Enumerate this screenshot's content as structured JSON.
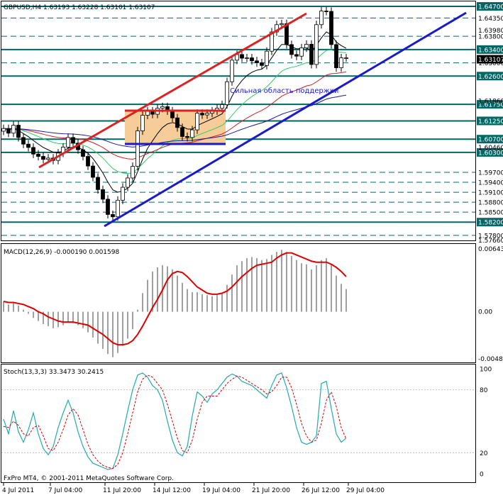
{
  "header": {
    "symbol_line": "GBPUSD,H4  1.63193 1.63228 1.63101 1.63107"
  },
  "chart_data": {
    "type": "candlestick",
    "symbol": "GBPUSD",
    "timeframe": "H4",
    "ohlc": {
      "open": 1.63193,
      "high": 1.63228,
      "low": 1.63101,
      "close": 1.63107
    },
    "price_range": [
      1.5767,
      1.6485
    ],
    "levels": [
      1.647,
      1.6435,
      1.638,
      1.634,
      1.63,
      1.626,
      1.6175,
      1.6125,
      1.607,
      1.603,
      1.597,
      1.594,
      1.591,
      1.588,
      1.585,
      1.582,
      1.578
    ],
    "level_labels": [
      "1.64700",
      "1.64350",
      "1.63800",
      "1.63400",
      "1.63000",
      "1.62600",
      "1.61750",
      "1.61250",
      "1.60700",
      "1.60300",
      "1.59700",
      "1.59400",
      "1.59100",
      "1.58800",
      "1.58500",
      "1.58200",
      "1.57800"
    ],
    "highlighted_labels": [
      "1.64700",
      "1.63400",
      "1.62600",
      "1.61750",
      "1.61250",
      "1.60700",
      "1.60300",
      "1.58200"
    ],
    "extra_price_labels": [
      "1.63980",
      "1.61860",
      "1.60460",
      "1.57660"
    ],
    "current_price_label": "1.63107",
    "x_tick_labels": [
      "4 Jul 2011",
      "7 Jul 04:00",
      "11 Jul 20:00",
      "14 Jul 12:00",
      "19 Jul 04:00",
      "21 Jul 20:00",
      "26 Jul 12:00",
      "29 Jul 04:00"
    ],
    "annotation": "Сильная область поддержки",
    "closes": [
      1.6102,
      1.6088,
      1.6112,
      1.6075,
      1.6055,
      1.6045,
      1.6025,
      1.6018,
      1.6009,
      1.6013,
      1.6006,
      1.6028,
      1.6046,
      1.6075,
      1.6058,
      1.6038,
      1.6018,
      1.5989,
      1.5955,
      1.5918,
      1.5889,
      1.5843,
      1.5836,
      1.5886,
      1.5925,
      1.5953,
      1.5988,
      1.6095,
      1.6142,
      1.6155,
      1.6145,
      1.6163,
      1.6168,
      1.6155,
      1.6134,
      1.6105,
      1.6078,
      1.6075,
      1.6098,
      1.6148,
      1.6143,
      1.6148,
      1.6155,
      1.6163,
      1.6174,
      1.6243,
      1.6308,
      1.6325,
      1.6314,
      1.6315,
      1.6306,
      1.63,
      1.6292,
      1.6335,
      1.6393,
      1.6415,
      1.6418,
      1.6355,
      1.6325,
      1.632,
      1.6345,
      1.6356,
      1.6295,
      1.6415,
      1.6456,
      1.6455,
      1.6355,
      1.6285,
      1.6315,
      1.6315
    ],
    "indicators": {
      "macd": {
        "label": "MACD(12,26,9) -0.000190 0.001598",
        "range": [
          -0.00484,
          0.00643
        ],
        "tick_labels": [
          "0.00643",
          "0.00",
          "-0.00484"
        ],
        "main": [
          0.001,
          0.0007,
          0.0009,
          0.0006,
          0.0002,
          -0.0002,
          -0.0006,
          -0.0009,
          -0.0012,
          -0.0014,
          -0.0016,
          -0.0015,
          -0.0013,
          -0.001,
          -0.0011,
          -0.0013,
          -0.0016,
          -0.002,
          -0.0025,
          -0.0031,
          -0.0036,
          -0.0041,
          -0.0044,
          -0.004,
          -0.0033,
          -0.0026,
          -0.0017,
          0.0002,
          0.0018,
          0.0031,
          0.0039,
          0.0043,
          0.0045,
          0.0044,
          0.0041,
          0.0035,
          0.0028,
          0.0022,
          0.0019,
          0.0019,
          0.0017,
          0.0016,
          0.0015,
          0.0016,
          0.0018,
          0.0026,
          0.0036,
          0.0045,
          0.0049,
          0.0052,
          0.0053,
          0.0052,
          0.005,
          0.0051,
          0.0055,
          0.0058,
          0.006,
          0.0058,
          0.0054,
          0.005,
          0.0047,
          0.0046,
          0.0041,
          0.0045,
          0.005,
          0.0052,
          0.0046,
          0.0035,
          0.0027,
          0.0022
        ],
        "signal": [
          0.001,
          0.0009,
          0.0009,
          0.0008,
          0.0007,
          0.0005,
          0.0003,
          0.0,
          -0.0002,
          -0.0005,
          -0.0007,
          -0.0009,
          -0.001,
          -0.001,
          -0.001,
          -0.0011,
          -0.0012,
          -0.0013,
          -0.0016,
          -0.0019,
          -0.0022,
          -0.0026,
          -0.003,
          -0.0032,
          -0.0032,
          -0.0031,
          -0.0028,
          -0.0022,
          -0.0014,
          -0.0005,
          0.0004,
          0.0012,
          0.0021,
          0.0031,
          0.0037,
          0.0039,
          0.0038,
          0.0034,
          0.0029,
          0.0024,
          0.0021,
          0.0018,
          0.0017,
          0.0017,
          0.0018,
          0.002,
          0.0024,
          0.0029,
          0.0034,
          0.0038,
          0.0042,
          0.0045,
          0.0046,
          0.0047,
          0.0048,
          0.0052,
          0.0055,
          0.0057,
          0.0057,
          0.0055,
          0.0053,
          0.0051,
          0.0049,
          0.0048,
          0.0048,
          0.0048,
          0.0046,
          0.0043,
          0.0039,
          0.0034
        ]
      },
      "stochastic": {
        "label": "Stoch(13,3,3) 33.3473 30.2415",
        "range": [
          0,
          100
        ],
        "tick_labels": [
          "100",
          "80",
          "20",
          "0"
        ],
        "k": [
          52,
          38,
          60,
          40,
          30,
          42,
          58,
          38,
          24,
          18,
          26,
          44,
          58,
          70,
          58,
          40,
          26,
          16,
          10,
          8,
          6,
          4,
          5,
          18,
          38,
          60,
          80,
          94,
          96,
          92,
          84,
          80,
          70,
          50,
          32,
          20,
          17,
          26,
          55,
          78,
          74,
          68,
          76,
          80,
          86,
          92,
          95,
          93,
          88,
          86,
          84,
          80,
          76,
          72,
          84,
          94,
          96,
          82,
          64,
          44,
          30,
          28,
          30,
          36,
          86,
          88,
          62,
          38,
          30,
          34
        ],
        "d": [
          45,
          44,
          50,
          46,
          38,
          36,
          44,
          46,
          36,
          24,
          22,
          30,
          42,
          56,
          62,
          56,
          42,
          28,
          18,
          12,
          8,
          6,
          5,
          9,
          20,
          38,
          58,
          78,
          90,
          94,
          92,
          86,
          80,
          66,
          50,
          34,
          22,
          20,
          32,
          52,
          68,
          74,
          74,
          74,
          80,
          86,
          90,
          93,
          92,
          89,
          86,
          83,
          80,
          76,
          78,
          84,
          92,
          92,
          82,
          66,
          48,
          36,
          30,
          32,
          48,
          70,
          78,
          64,
          44,
          33
        ]
      }
    }
  },
  "footer": {
    "copyright": "FxPro MT4, © 2001-2011 MetaQuotes Software Corp."
  },
  "colors": {
    "bull_candle_fill": "#ffffff",
    "bear_candle_fill": "#000000",
    "level_teal": "#006666",
    "highlight_label_bg": "#006666",
    "red_channel": "#dd2222",
    "blue_channel": "#1a1acc",
    "rect_fill": "#f6cc98",
    "macd_signal": "#dd0000",
    "stoch_main": "#22aab0",
    "stoch_signal": "#cc0000"
  }
}
